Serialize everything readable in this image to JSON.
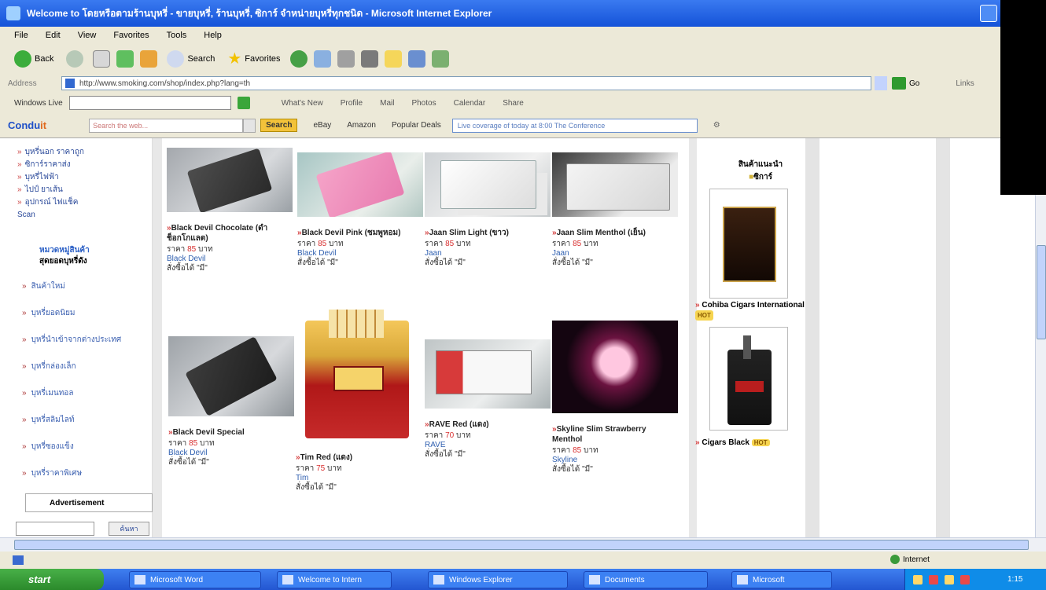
{
  "window": {
    "title": "Welcome to โดยหรือตามร้านบุหรี่ - ขายบุหรี่, ร้านบุหรี่, ซิการ์ จำหน่ายบุหรี่ทุกชนิด - Microsoft Internet Explorer"
  },
  "menu": [
    "File",
    "Edit",
    "View",
    "Favorites",
    "Tools",
    "Help"
  ],
  "toolbar": {
    "back": "Back",
    "search": "Search",
    "favorites": "Favorites"
  },
  "address": {
    "label": "Address",
    "url": "http://www.smoking.com/shop/index.php?lang=th",
    "go": "Go",
    "links": "Links"
  },
  "windows_live": {
    "label": "Windows Live",
    "items": [
      "What's New",
      "Profile",
      "Mail",
      "Photos",
      "Calendar",
      "Share"
    ]
  },
  "conduit": {
    "logo_a": "Condu",
    "logo_b": "it",
    "search_placeholder": "Search the web...",
    "search_btn": "Search",
    "items": [
      "eBay",
      "Amazon",
      "Popular Deals"
    ],
    "dropdown": "Live coverage of today at 8:00 The Conference"
  },
  "sidebar": {
    "top_links": [
      "บุหรี่นอก ราคาถูก",
      "ซิการ์ราคาส่ง",
      "บุหรี่ไฟฟ้า",
      "ไปป์ ยาเส้น",
      "อุปกรณ์ ไฟแช็ค"
    ],
    "extra": "Scan",
    "brand_line1": "หมวดหมู่สินค้า",
    "brand_line2": "สุดยอดบุหรี่ดัง",
    "categories": [
      "สินค้าใหม่",
      "บุหรี่ยอดนิยม",
      "บุหรี่นำเข้าจากต่างประเทศ",
      "บุหรี่กล่องเล็ก",
      "บุหรี่เมนทอล",
      "บุหรี่สลิมไลท์",
      "บุหรี่ซองแข็ง",
      "บุหรี่ราคาพิเศษ"
    ],
    "advertise": "Advertisement",
    "search_btn": "ค้นหา"
  },
  "products": [
    {
      "name": "Black Devil Chocolate (ดำ ช็อกโกแลต)",
      "price_label": "ราคา",
      "price": "85",
      "unit": "บาท",
      "brand": "Black Devil",
      "stock_label": "สั่งซื้อได้",
      "stock": "มี"
    },
    {
      "name": "Black Devil Pink (ชมพูหอม)",
      "price_label": "ราคา",
      "price": "85",
      "unit": "บาท",
      "brand": "Black Devil",
      "stock_label": "สั่งซื้อได้",
      "stock": "มี"
    },
    {
      "name": "Jaan Slim Light (ขาว)",
      "price_label": "ราคา",
      "price": "85",
      "unit": "บาท",
      "brand": "Jaan",
      "stock_label": "สั่งซื้อได้",
      "stock": "มี"
    },
    {
      "name": "Jaan Slim Menthol (เย็น)",
      "price_label": "ราคา",
      "price": "85",
      "unit": "บาท",
      "brand": "Jaan",
      "stock_label": "สั่งซื้อได้",
      "stock": "มี"
    },
    {
      "name": "Black Devil Special",
      "price_label": "ราคา",
      "price": "85",
      "unit": "บาท",
      "brand": "Black Devil",
      "stock_label": "สั่งซื้อได้",
      "stock": "มี"
    },
    {
      "name": "Tim Red (แดง)",
      "price_label": "ราคา",
      "price": "75",
      "unit": "บาท",
      "brand": "Tim",
      "stock_label": "สั่งซื้อได้",
      "stock": "มี"
    },
    {
      "name": "RAVE Red (แดง)",
      "price_label": "ราคา",
      "price": "70",
      "unit": "บาท",
      "brand": "RAVE",
      "stock_label": "สั่งซื้อได้",
      "stock": "มี"
    },
    {
      "name": "Skyline Slim Strawberry Menthol",
      "price_label": "ราคา",
      "price": "85",
      "unit": "บาท",
      "brand": "Skyline",
      "stock_label": "สั่งซื้อได้",
      "stock": "มี"
    }
  ],
  "right": {
    "heading": "สินค้าแนะนำ",
    "sub": "ซิการ์",
    "ad1_caption": "Cohiba Cigars International",
    "ad2_caption": "Cigars Black",
    "hot": "HOT"
  },
  "status": {
    "zone": "Internet"
  },
  "taskbar": {
    "start": "start",
    "tasks": [
      "Microsoft Word",
      "Welcome to Intern",
      "Windows Explorer",
      "Documents",
      "Microsoft"
    ],
    "clock": "1:15"
  }
}
